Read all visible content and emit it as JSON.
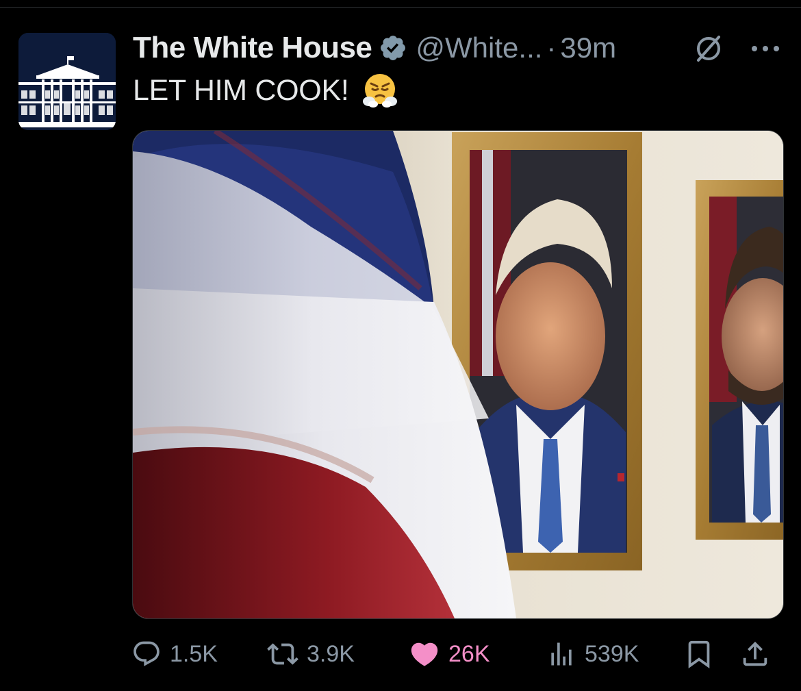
{
  "tweet": {
    "display_name": "The White House",
    "handle": "@White...",
    "separator": "·",
    "time": "39m",
    "text": "LET HIM COOK!",
    "emoji": "face-with-steam-from-nose",
    "avatar_icon": "white-house-logo-icon",
    "verified_icon": "verified-badge-icon",
    "media_description_icon": "tweet-photo"
  },
  "actions": {
    "replies": "1.5K",
    "reposts": "3.9K",
    "likes": "26K",
    "views": "539K",
    "liked": true,
    "like_color": "#f91880",
    "icon_color": "#8b98a5"
  },
  "colors": {
    "background": "#000000",
    "text_primary": "#e7e9ea",
    "text_secondary": "#8b98a5",
    "like": "#f91880"
  }
}
